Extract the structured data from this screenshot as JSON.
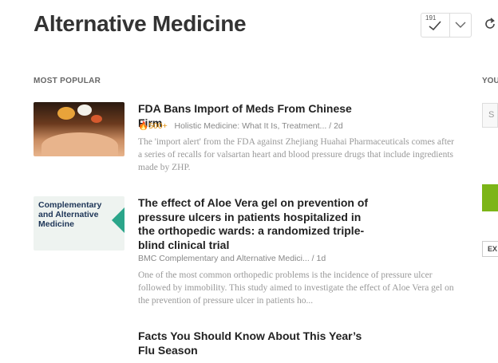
{
  "header": {
    "title": "Alternative Medicine",
    "unread_count": "191"
  },
  "section": {
    "label": "MOST POPULAR"
  },
  "right_panel": {
    "label": "YOU",
    "search_letter": "S",
    "export_label": "EX"
  },
  "articles": [
    {
      "title": "FDA Bans Import of Meds From Chinese Firm",
      "popularity": "500+",
      "source": "Holistic Medicine: What It Is, Treatment...",
      "age": "2d",
      "snippet": "The 'import alert' from the FDA against Zhejiang Huahai Pharmaceuticals comes after a series of recalls for valsartan heart and blood pressure drugs that include ingredients made by ZHP."
    },
    {
      "title": "The effect of Aloe Vera gel on prevention of pressure ulcers in patients hospitalized in the orthopedic wards: a randomized triple-blind clinical trial",
      "source": "BMC Complementary and Alternative Medici...",
      "age": "1d",
      "snippet": "One of the most common orthopedic problems is the incidence of pressure ulcer followed by immobility. This study aimed to investigate the effect of Aloe Vera gel on the prevention of pressure ulcer in patients ho...",
      "thumb_text": "Complementary and Alternative Medicine"
    },
    {
      "title": "Facts You Should Know About This Year’s Flu Season"
    }
  ],
  "colors": {
    "popularity": "#e08a00",
    "title": "#222222",
    "meta": "#888888"
  }
}
